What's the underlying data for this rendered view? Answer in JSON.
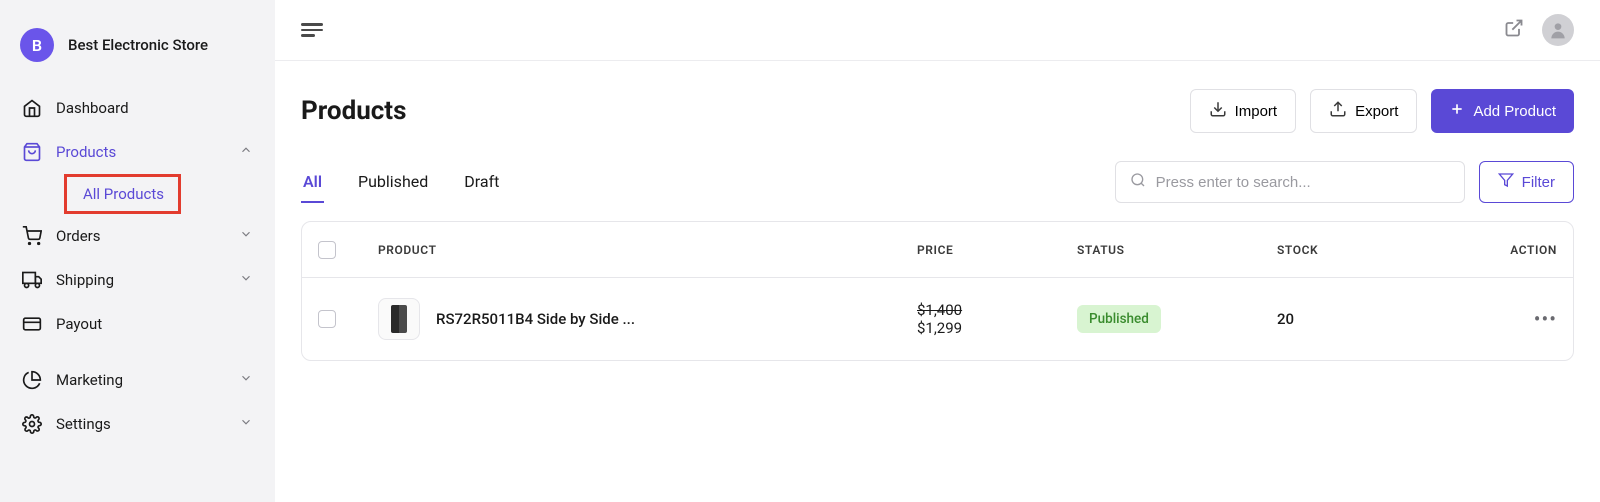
{
  "store": {
    "avatar_letter": "B",
    "name": "Best Electronic Store"
  },
  "sidebar": {
    "items": [
      {
        "label": "Dashboard",
        "icon": "home"
      },
      {
        "label": "Products",
        "icon": "bag",
        "active": true,
        "sub": [
          {
            "label": "All Products"
          }
        ]
      },
      {
        "label": "Orders",
        "icon": "cart"
      },
      {
        "label": "Shipping",
        "icon": "truck"
      },
      {
        "label": "Payout",
        "icon": "wallet"
      },
      {
        "label": "Marketing",
        "icon": "pie"
      },
      {
        "label": "Settings",
        "icon": "gear"
      }
    ]
  },
  "page": {
    "title": "Products"
  },
  "actions": {
    "import": "Import",
    "export": "Export",
    "add": "Add Product",
    "filter": "Filter"
  },
  "tabs": {
    "all": "All",
    "published": "Published",
    "draft": "Draft"
  },
  "search": {
    "placeholder": "Press enter to search..."
  },
  "table": {
    "headers": {
      "product": "PRODUCT",
      "price": "PRICE",
      "status": "STATUS",
      "stock": "STOCK",
      "action": "ACTION"
    },
    "rows": [
      {
        "name": "RS72R5011B4 Side by Side ...",
        "price_old": "$1,400",
        "price_new": "$1,299",
        "status": "Published",
        "stock": "20"
      }
    ]
  }
}
